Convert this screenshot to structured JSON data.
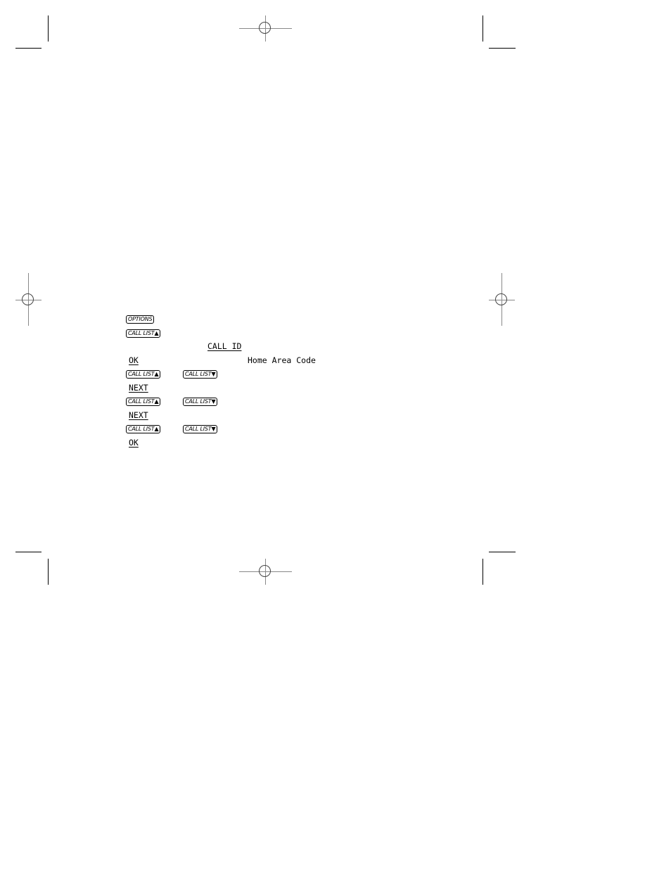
{
  "steps": [
    {
      "key": "OPTIONS"
    },
    {
      "key": "CALL LIST",
      "arrow": "▲"
    },
    {
      "display": "CALL ID"
    },
    {
      "softkey": "OK",
      "display": "Home Area Code"
    },
    {
      "keys": [
        {
          "key": "CALL LIST",
          "arrow": "▲"
        },
        {
          "key": "CALL LIST",
          "arrow": "▼"
        }
      ]
    },
    {
      "softkey": "NEXT"
    },
    {
      "keys": [
        {
          "key": "CALL LIST",
          "arrow": "▲"
        },
        {
          "key": "CALL LIST",
          "arrow": "▼"
        }
      ]
    },
    {
      "softkey": "NEXT"
    },
    {
      "keys": [
        {
          "key": "CALL LIST",
          "arrow": "▲"
        },
        {
          "key": "CALL LIST",
          "arrow": "▼"
        }
      ]
    },
    {
      "softkey": "OK"
    }
  ],
  "labels": {
    "options": "OPTIONS",
    "call_list_up": "CALL LIST▲",
    "call_list_down": "CALL LIST▼",
    "call_id": "CALL ID",
    "ok": "OK",
    "next": "NEXT",
    "home_area_code": "Home Area Code"
  }
}
